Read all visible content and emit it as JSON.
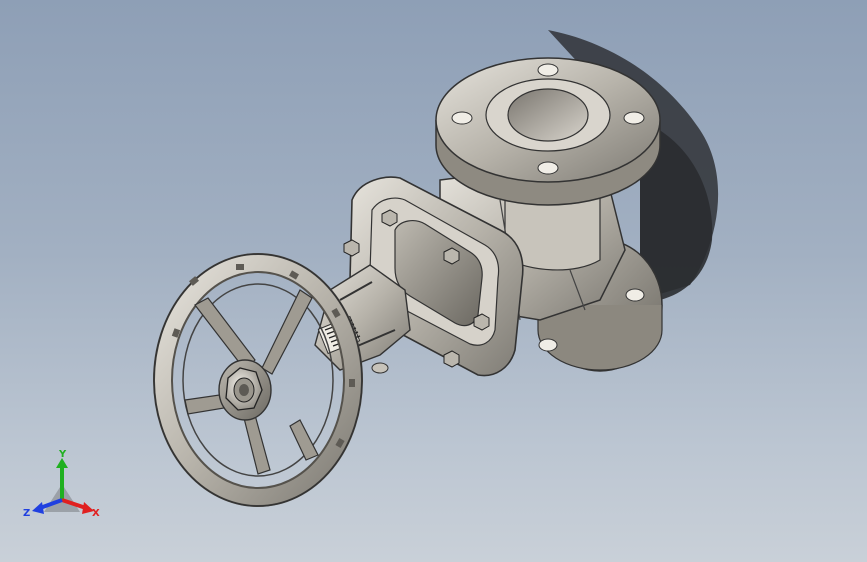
{
  "viewport": {
    "background_top": "#8e9fb6",
    "background_bottom": "#c9d0d8",
    "model": "gate-valve-assembly"
  },
  "triad": {
    "x_label": "X",
    "y_label": "Y",
    "z_label": "Z",
    "x_color": "#e02020",
    "y_color": "#20b020",
    "z_color": "#2040e0"
  }
}
